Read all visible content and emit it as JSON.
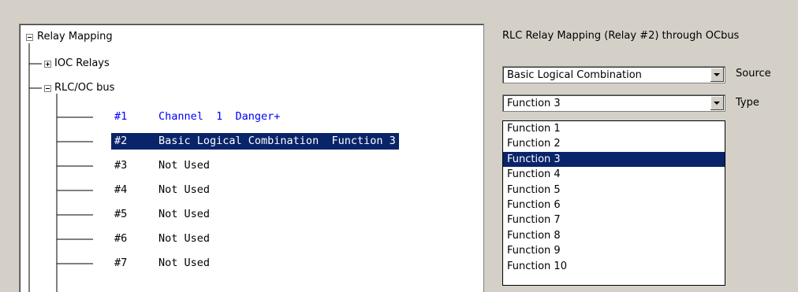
{
  "tree": {
    "root_label": "Relay Mapping",
    "ioc_label": "IOC Relays",
    "rlc_label": "RLC/OC bus",
    "relays": [
      {
        "num": "#1",
        "text": "Channel  1  Danger+",
        "state": "active"
      },
      {
        "num": "#2",
        "text": "Basic Logical Combination  Function 3",
        "state": "selected"
      },
      {
        "num": "#3",
        "text": "Not Used",
        "state": "normal"
      },
      {
        "num": "#4",
        "text": "Not Used",
        "state": "normal"
      },
      {
        "num": "#5",
        "text": "Not Used",
        "state": "normal"
      },
      {
        "num": "#6",
        "text": "Not Used",
        "state": "normal"
      },
      {
        "num": "#7",
        "text": "Not Used",
        "state": "normal"
      }
    ]
  },
  "panel": {
    "title": "RLC Relay Mapping (Relay #2) through OCbus",
    "source_value": "Basic Logical Combination",
    "source_label": "Source",
    "type_value": "Function 3",
    "type_label": "Type",
    "type_options": [
      "Function 1",
      "Function 2",
      "Function 3",
      "Function 4",
      "Function 5",
      "Function 6",
      "Function 7",
      "Function 8",
      "Function 9",
      "Function 10"
    ],
    "type_selected": "Function 3"
  },
  "colors": {
    "selection_bg": "#0a246a",
    "active_text": "#0000ff",
    "window_bg": "#d4d0c8"
  }
}
